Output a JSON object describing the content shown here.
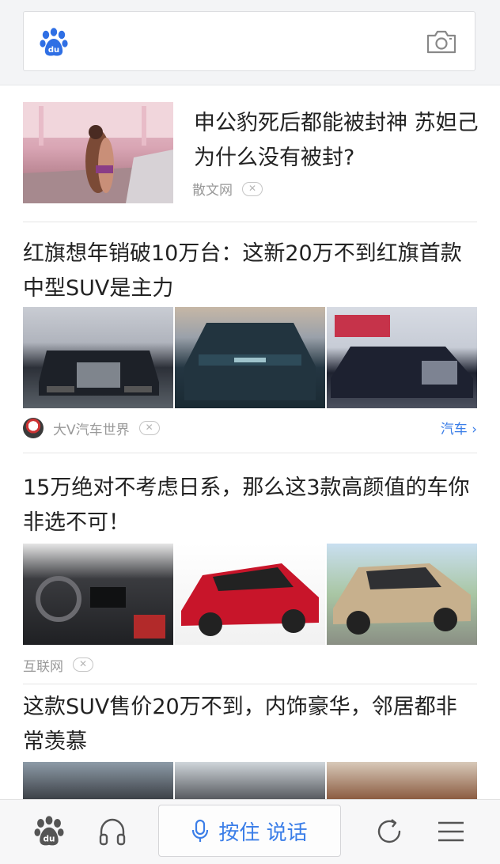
{
  "header": {
    "logo_icon": "baidu-paw-icon",
    "camera_icon": "camera-icon"
  },
  "feed": [
    {
      "title": "申公豹死后都能被封神 苏妲己为什么没有被封?",
      "source": "散文网",
      "close": "✕"
    },
    {
      "title": "红旗想年销破10万台：这新20万不到红旗首款中型SUV是主力",
      "source": "大V汽车世界",
      "close": "✕",
      "category": "汽车 ›"
    },
    {
      "title": "15万绝对不考虑日系，那么这3款高颜值的车你非选不可！",
      "source": "互联网",
      "close": "✕"
    },
    {
      "title": "这款SUV售价20万不到，内饰豪华，邻居都非常羡慕"
    }
  ],
  "bottom_bar": {
    "home_icon": "baidu-paw-icon",
    "audio_icon": "headphones-icon",
    "voice_label": "按住 说话",
    "refresh_icon": "refresh-icon",
    "menu_icon": "menu-icon"
  },
  "colors": {
    "brand_blue": "#3b7ee8",
    "text": "#222222",
    "meta": "#999999"
  }
}
